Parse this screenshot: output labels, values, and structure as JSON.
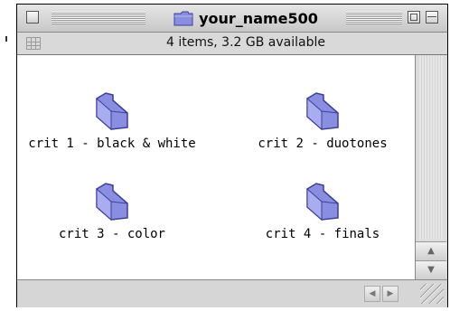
{
  "window": {
    "title": "your_name500",
    "status": "4 items, 3.2 GB available",
    "accent_color": "#8a8ee0"
  },
  "items": [
    {
      "label": "crit 1 - black & white",
      "icon": "folder-icon"
    },
    {
      "label": "crit 2 - duotones",
      "icon": "folder-icon"
    },
    {
      "label": "crit 3 - color",
      "icon": "folder-icon"
    },
    {
      "label": "crit 4 - finals",
      "icon": "folder-icon"
    }
  ],
  "scroll": {
    "up_glyph": "▲",
    "down_glyph": "▼",
    "left_glyph": "◀",
    "right_glyph": "▶"
  }
}
